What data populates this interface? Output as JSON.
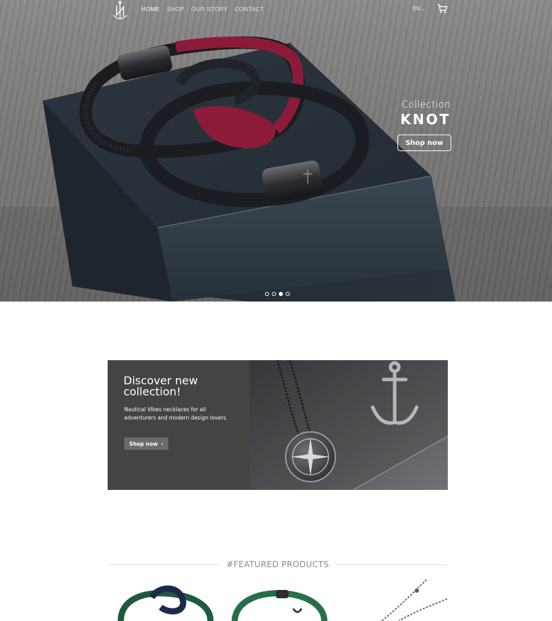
{
  "nav": {
    "logo_alt": "N",
    "links": [
      {
        "label": "HOME",
        "active": true
      },
      {
        "label": "SHOP",
        "active": false
      },
      {
        "label": "OUR STORY",
        "active": false
      },
      {
        "label": "CONTACT",
        "active": false
      }
    ],
    "language": "EN",
    "cart_icon": "cart-icon"
  },
  "hero": {
    "collection_label": "Collection",
    "collection_name": "KNOT",
    "button_label": "Shop now",
    "slides_count": 4,
    "active_slide": 3
  },
  "promo": {
    "title": "Discover new collection!",
    "text": "Nautical Vibes necklaces for all adventurers and modern design lovers.",
    "button_label": "Shop now",
    "button_icon": "chevron-right-icon"
  },
  "featured": {
    "title": "#FEATURED PRODUCTS",
    "products": [
      "green-navy-knot-bracelet",
      "green-anchor-bracelet",
      "chain-necklace"
    ]
  },
  "colors": {
    "promo_panel": "#454445",
    "promo_button": "#6c6b6c",
    "text_light": "#ffffff",
    "featured_title": "#8a8a8a"
  }
}
